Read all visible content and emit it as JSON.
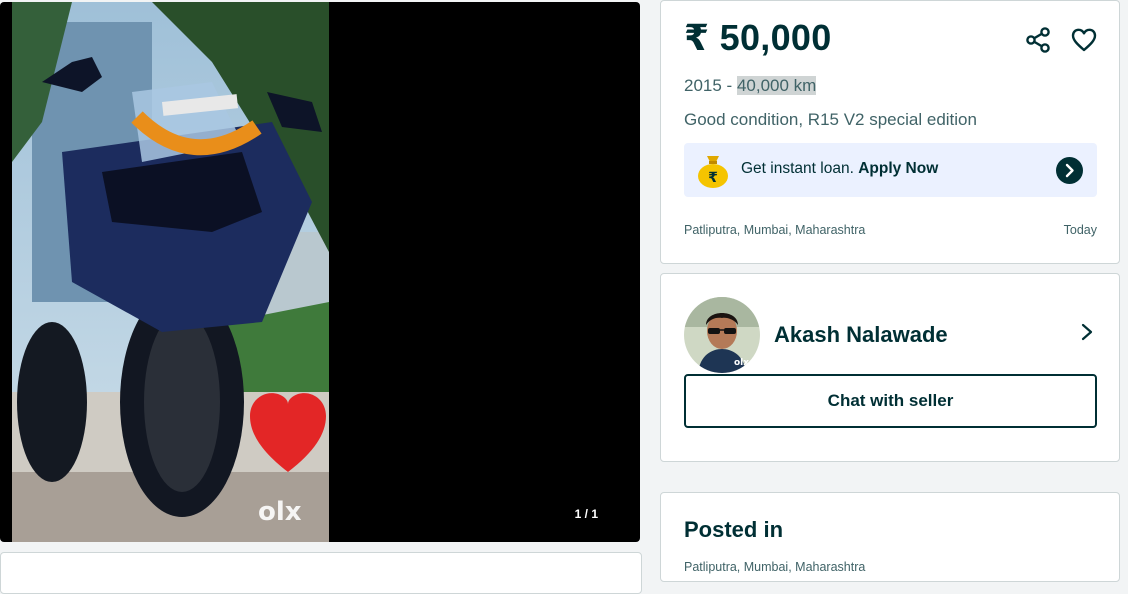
{
  "gallery": {
    "counter": "1 / 1",
    "watermark": "olx"
  },
  "ad": {
    "price": "₹ 50,000",
    "year": "2015",
    "separator": " - ",
    "km": "40,000 km",
    "title": "Good condition, R15 V2 special edition",
    "location": "Patliputra, Mumbai, Maharashtra",
    "date": "Today"
  },
  "loan": {
    "text": "Get instant loan. ",
    "apply": "Apply Now",
    "icon": "money-bag-icon"
  },
  "seller": {
    "name": "Akash Nalawade",
    "chat_label": "Chat with seller"
  },
  "posted": {
    "title": "Posted in",
    "location": "Patliputra, Mumbai, Maharashtra"
  },
  "colors": {
    "primary": "#002f34",
    "loan_bg": "#ebf1ff",
    "page_bg": "#f2f4f5"
  }
}
